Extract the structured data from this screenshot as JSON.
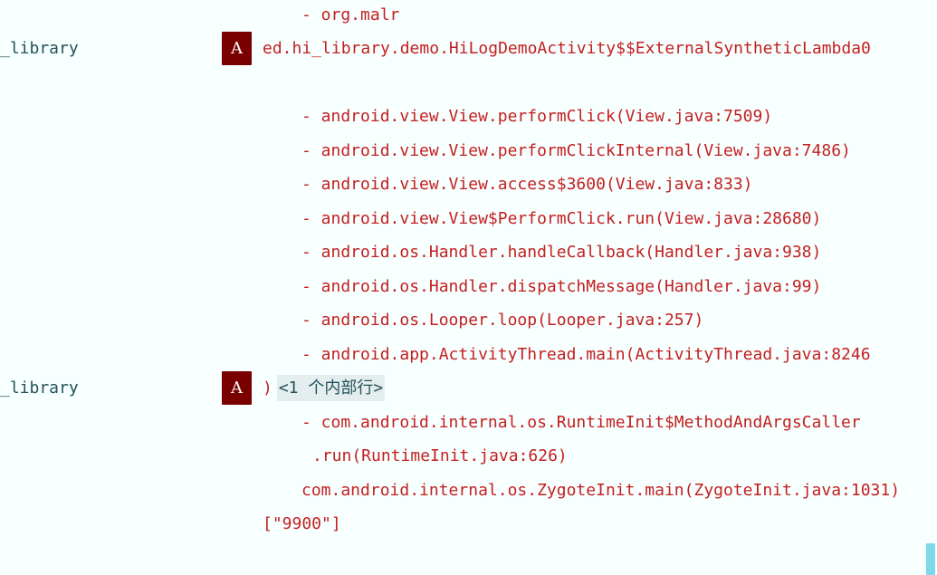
{
  "rows": {
    "l0": "- org.malr",
    "tag1": "_library",
    "badge1": "A",
    "l1": "ed.hi_library.demo.HiLogDemoActivity$$ExternalSyntheticLambda0",
    "l2": "- android.view.View.performClick(View.java:7509)",
    "l3": "- android.view.View.performClickInternal(View.java:7486)",
    "l4": "- android.view.View.access$3600(View.java:833)",
    "l5": "- android.view.View$PerformClick.run(View.java:28680)",
    "l6": "- android.os.Handler.handleCallback(Handler.java:938)",
    "l7": "- android.os.Handler.dispatchMessage(Handler.java:99)",
    "l8": "- android.os.Looper.loop(Looper.java:257)",
    "l9": "- android.app.ActivityThread.main(ActivityThread.java:8246",
    "tag2": "_library",
    "badge2": "A",
    "l10_paren": ")",
    "l10_fold": "<1 个内部行>",
    "l11": "- com.android.internal.os.RuntimeInit$MethodAndArgsCaller",
    "l12": ".run(RuntimeInit.java:626)",
    "l13": "com.android.internal.os.ZygoteInit.main(ZygoteInit.java:1031)",
    "l14": "[\"9900\"]"
  }
}
